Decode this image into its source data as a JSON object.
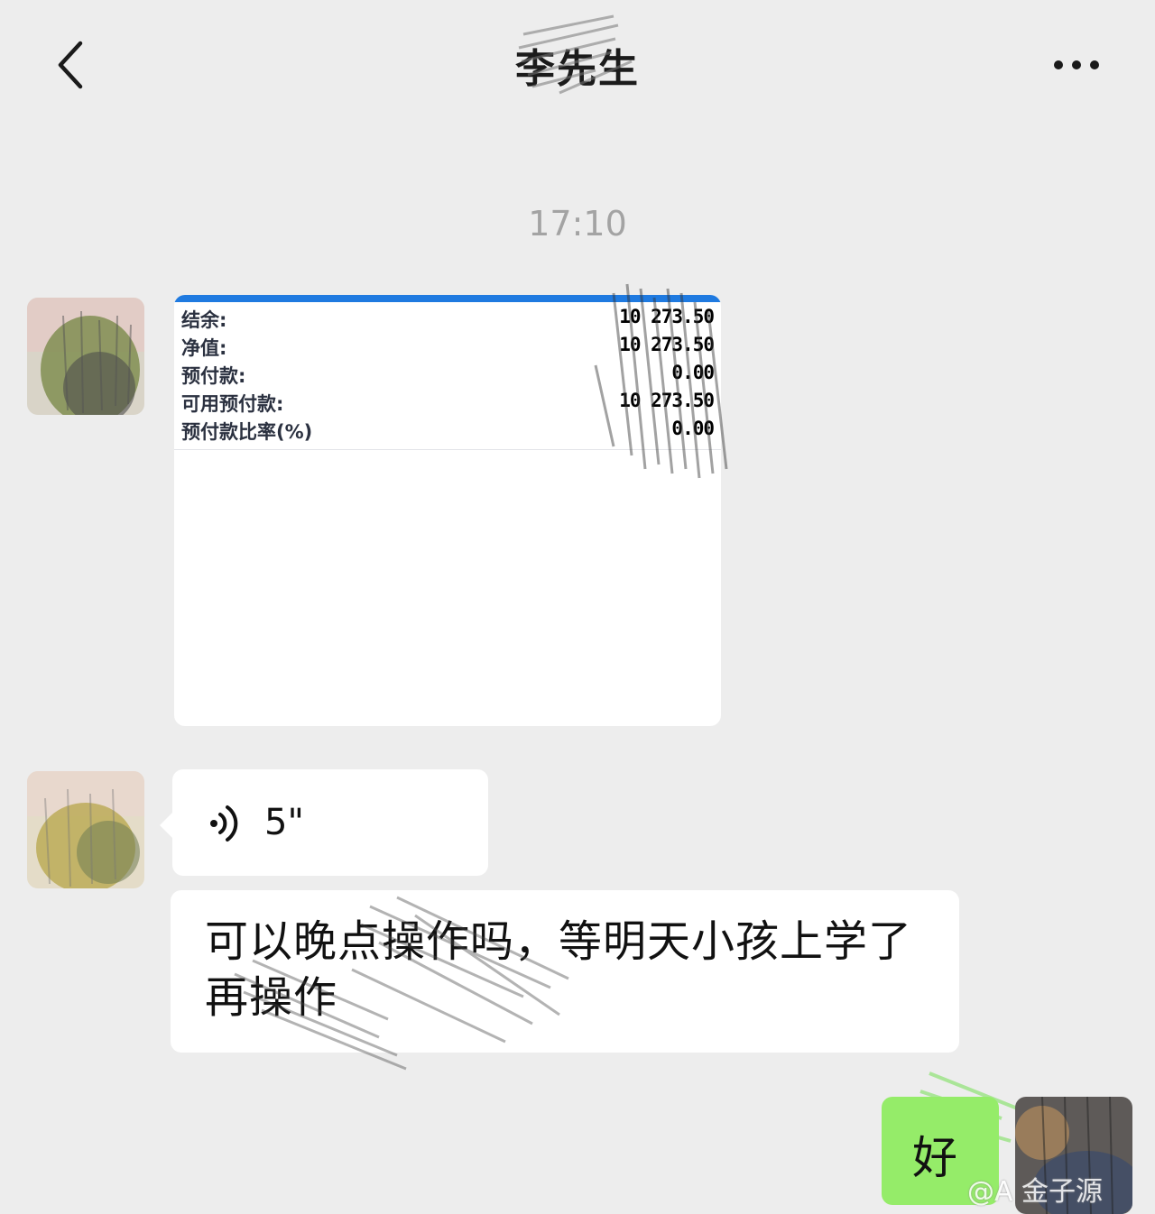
{
  "header": {
    "back_icon": "chevron-left-icon",
    "title": "李先生",
    "more_icon": "more-dots-icon"
  },
  "timestamp": "17:10",
  "messages": {
    "image_card": {
      "rows": [
        {
          "label": "结余:",
          "value": "10 273.50"
        },
        {
          "label": "净值:",
          "value": "10 273.50"
        },
        {
          "label": "预付款:",
          "value": "0.00"
        },
        {
          "label": "可用预付款:",
          "value": "10 273.50"
        },
        {
          "label": "预付款比率(%)",
          "value": "0.00"
        }
      ],
      "accent_color": "#1f7ae0"
    },
    "voice": {
      "icon": "voice-wave-icon",
      "duration": "5\""
    },
    "text": "可以晚点操作吗，等明天小孩上学了再操作",
    "my_reply": "好"
  },
  "colors": {
    "background": "#ededed",
    "my_bubble": "#95ec69",
    "their_bubble": "#ffffff"
  },
  "watermark": "@A 金子源"
}
